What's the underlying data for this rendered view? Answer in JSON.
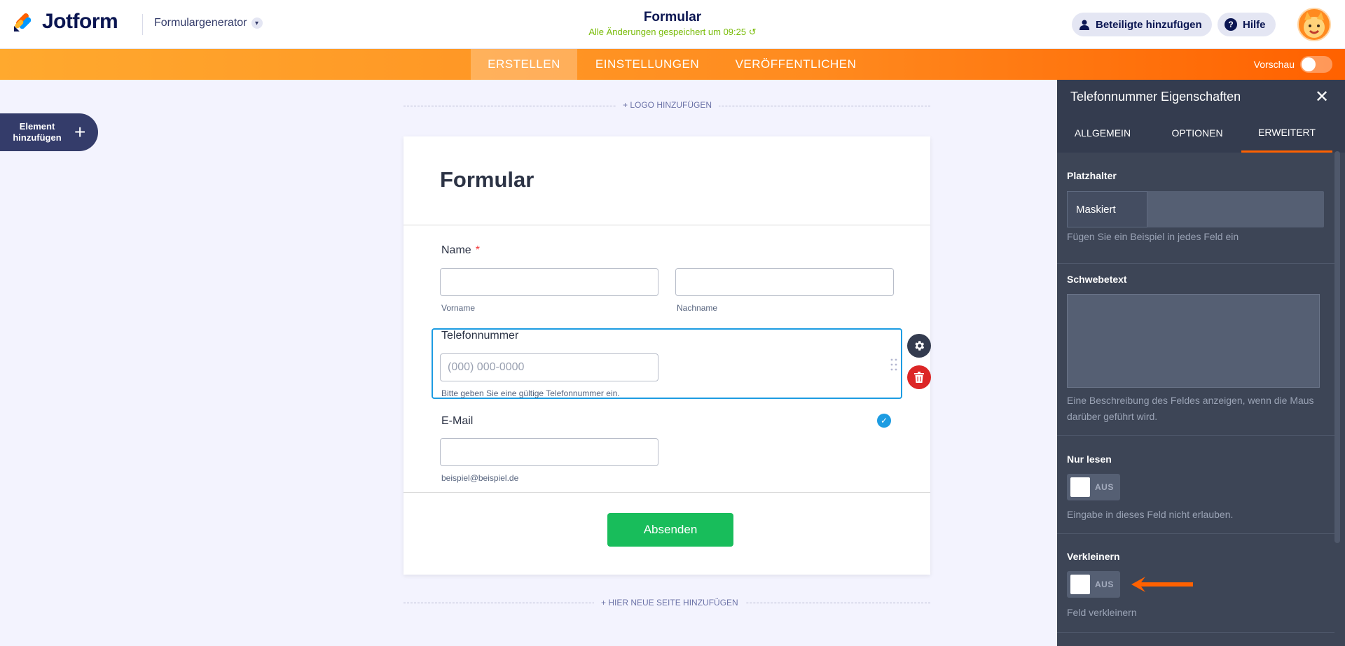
{
  "topbar": {
    "brand": "Jotform",
    "builder_label": "Formulargenerator",
    "form_title": "Formular",
    "save_status": "Alle Änderungen gespeichert um 09:25",
    "invite_label": "Beteiligte hinzufügen",
    "help_label": "Hilfe"
  },
  "nav": {
    "tabs": [
      {
        "label": "ERSTELLEN",
        "active": true
      },
      {
        "label": "EINSTELLUNGEN",
        "active": false
      },
      {
        "label": "VERÖFFENTLICHEN",
        "active": false
      }
    ],
    "preview_label": "Vorschau"
  },
  "add_element": {
    "label": "Element hinzufügen",
    "plus": "+"
  },
  "canvas": {
    "add_logo": "+ LOGO HINZUFÜGEN",
    "add_page": "+ HIER NEUE SEITE HINZUFÜGEN"
  },
  "form": {
    "heading": "Formular",
    "name_label": "Name",
    "required_mark": "*",
    "first_name_sub": "Vorname",
    "last_name_sub": "Nachname",
    "phone_label": "Telefonnummer",
    "phone_placeholder": "(000) 000-0000",
    "phone_sub": "Bitte geben Sie eine gültige Telefonnummer ein.",
    "email_label": "E-Mail",
    "email_sub": "beispiel@beispiel.de",
    "submit_label": "Absenden"
  },
  "panel": {
    "title": "Telefonnummer Eigenschaften",
    "close": "✕",
    "tabs": [
      {
        "label": "ALLGEMEIN",
        "active": false
      },
      {
        "label": "OPTIONEN",
        "active": false
      },
      {
        "label": "ERWEITERT",
        "active": true
      }
    ],
    "placeholder": {
      "title": "Platzhalter",
      "option": "Maskiert",
      "desc": "Fügen Sie ein Beispiel in jedes Feld ein"
    },
    "hover_text": {
      "title": "Schwebetext",
      "desc": "Eine Beschreibung des Feldes anzeigen, wenn die Maus darüber geführt wird."
    },
    "read_only": {
      "title": "Nur lesen",
      "state": "AUS",
      "desc": "Eingabe in dieses Feld nicht erlauben."
    },
    "shrink": {
      "title": "Verkleinern",
      "state": "AUS",
      "desc": "Feld verkleinern"
    }
  },
  "colors": {
    "brand_orange": "#ff6100",
    "selection_blue": "#1d9ce2",
    "submit_green": "#18bd5b",
    "delete_red": "#dc2626",
    "save_green": "#78bb07"
  }
}
